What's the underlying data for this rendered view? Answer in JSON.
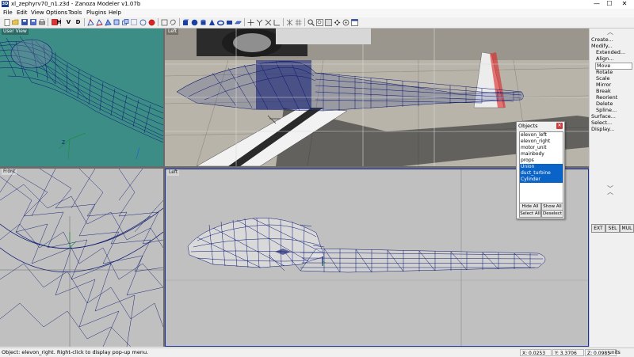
{
  "window": {
    "app_icon": "3D",
    "title": "xl_zephyrv70_n1.z3d - Zanoza Modeler v1.07b",
    "minimize": "—",
    "maximize": "☐",
    "close": "✕"
  },
  "menu": [
    "File",
    "Edit",
    "View",
    "Options",
    "Tools",
    "Plugins",
    "Help"
  ],
  "toolbar": {
    "view_letters": [
      "H",
      "V",
      "D"
    ]
  },
  "viewports": {
    "top_left": {
      "label": "User View"
    },
    "top_right": {
      "label": "Left"
    },
    "bottom_left": {
      "label": "Front"
    },
    "bottom_right": {
      "label": "Left"
    }
  },
  "side_panel": {
    "commands": [
      {
        "label": "Create...",
        "level": 0
      },
      {
        "label": "Modify...",
        "level": 0
      },
      {
        "label": "Extended...",
        "level": 1
      },
      {
        "label": "Align...",
        "level": 1
      },
      {
        "label": "Move",
        "level": 1,
        "selected": true
      },
      {
        "label": "Rotate",
        "level": 1
      },
      {
        "label": "Scale",
        "level": 1
      },
      {
        "label": "Mirror",
        "level": 1
      },
      {
        "label": "Break",
        "level": 1
      },
      {
        "label": "Reorient",
        "level": 1
      },
      {
        "label": "Delete",
        "level": 1
      },
      {
        "label": "Spline...",
        "level": 1
      },
      {
        "label": "Surface...",
        "level": 0
      },
      {
        "label": "Select...",
        "level": 0
      },
      {
        "label": "Display...",
        "level": 0
      }
    ],
    "mode_buttons": [
      "EXT",
      "SEL",
      "MUL"
    ]
  },
  "objects_window": {
    "title": "Objects",
    "items": [
      {
        "label": "elevon_left",
        "selected": false
      },
      {
        "label": "elevon_right",
        "selected": false
      },
      {
        "label": "motor_unit",
        "selected": false
      },
      {
        "label": "mainbody",
        "selected": false
      },
      {
        "label": "props",
        "selected": false
      },
      {
        "label": "Union",
        "selected": true
      },
      {
        "label": "duct_turbine",
        "selected": true
      },
      {
        "label": "Cylinder",
        "selected": true
      }
    ],
    "buttons": {
      "hide_all": "Hide All",
      "show_all": "Show All",
      "select_all": "Select All",
      "deselect": "Deselect"
    }
  },
  "status": {
    "message": "Object: elevon_right. Right-click to display pop-up menu.",
    "x": "X: 0.0253",
    "y": "Y: 3.3706",
    "z": "Z: 0.0985",
    "units": "units"
  },
  "colors": {
    "user_view_bg": "#3d8d87",
    "ortho_bg": "#c0c0c0",
    "mesh": "#0a1670",
    "selection": "#0a64c8"
  }
}
